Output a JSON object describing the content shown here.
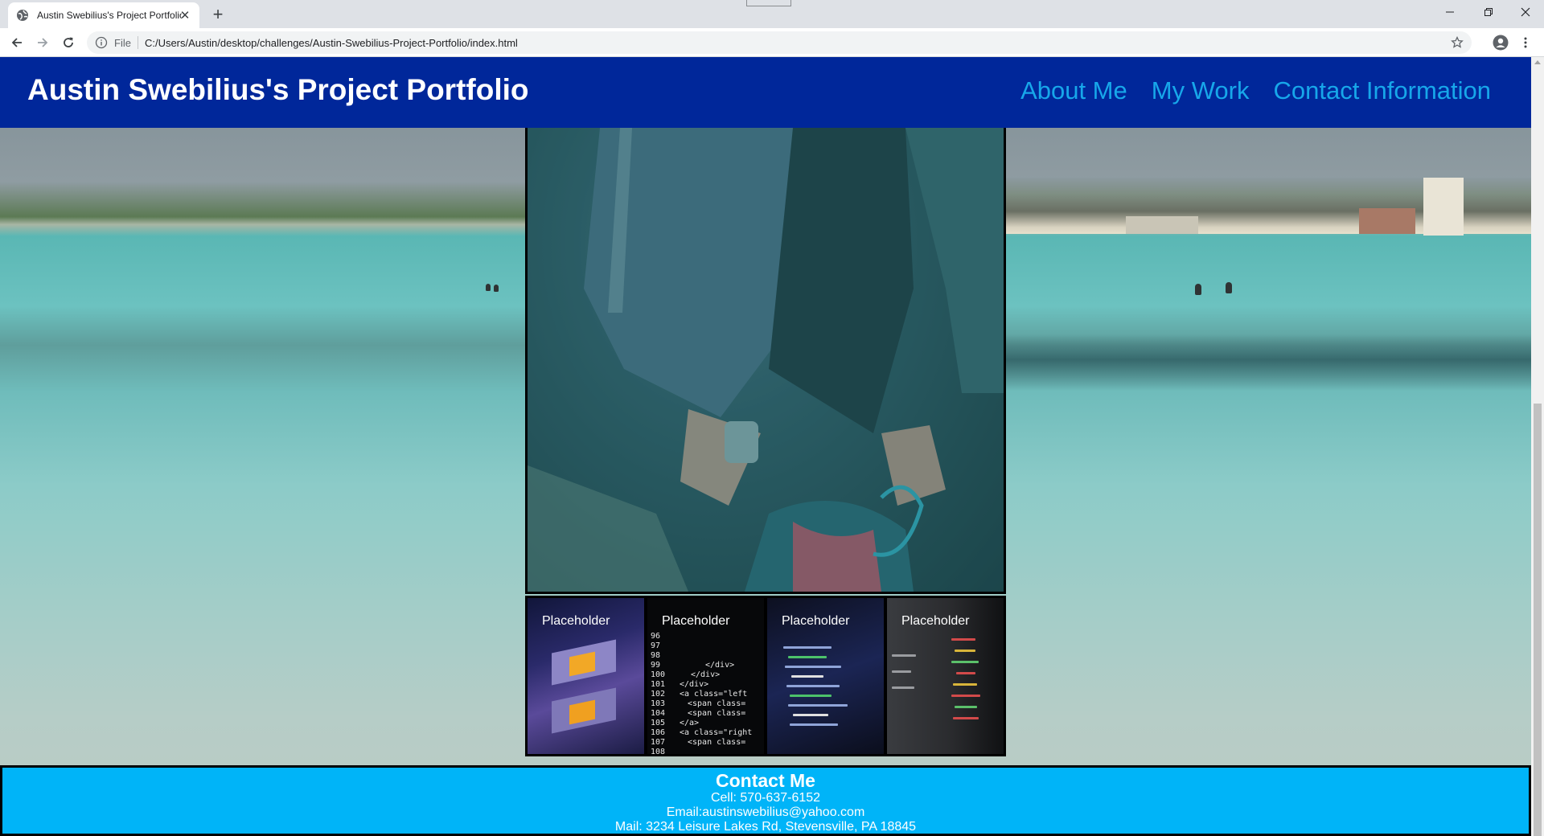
{
  "browser": {
    "tab_title": "Austin Swebilius's Project Portfolio",
    "scheme_label": "File",
    "url": "C:/Users/Austin/desktop/challenges/Austin-Swebilius-Project-Portfolio/index.html",
    "icons": {
      "favicon": "globe-icon",
      "close_tab": "close-icon",
      "new_tab": "plus-icon",
      "back": "back-arrow-icon",
      "forward": "forward-arrow-icon",
      "reload": "reload-icon",
      "site_info": "info-icon",
      "bookmark": "star-icon",
      "profile": "profile-icon",
      "menu": "more-vert-icon",
      "minimize": "minimize-icon",
      "restore": "restore-icon",
      "close_window": "close-icon"
    }
  },
  "site": {
    "title": "Austin Swebilius's Project Portfolio",
    "nav": [
      "About Me",
      "My Work",
      "Contact Information"
    ],
    "thumbnails": [
      "Placeholder",
      "Placeholder",
      "Placeholder",
      "Placeholder"
    ],
    "contact": {
      "heading": "Contact Me",
      "cell": "Cell: 570-637-6152",
      "email": "Email:austinswebilius@yahoo.com",
      "mail": "Mail: 3234 Leisure Lakes Rd, Stevensville, PA 18845"
    },
    "colors": {
      "header_bg": "#00279a",
      "nav_link": "#17a7ea",
      "contact_bg": "#00b4f8"
    }
  }
}
